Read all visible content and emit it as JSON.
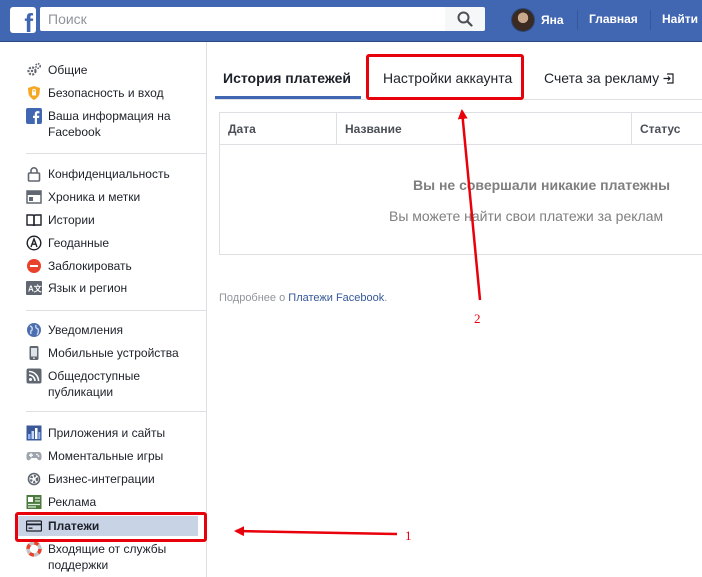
{
  "topbar": {
    "logo": "f",
    "search_placeholder": "Поиск",
    "user_name": "Яна",
    "home_label": "Главная",
    "find_friends_label": "Найти"
  },
  "sidebar": {
    "groups": [
      [
        {
          "icon": "gear-icon",
          "label": "Общие"
        },
        {
          "icon": "shield-icon",
          "label": "Безопасность и вход"
        },
        {
          "icon": "facebook-icon",
          "label": "Ваша информация на Facebook"
        }
      ],
      [
        {
          "icon": "lock-icon",
          "label": "Конфиденциальность"
        },
        {
          "icon": "timeline-icon",
          "label": "Хроника и метки"
        },
        {
          "icon": "book-icon",
          "label": "Истории"
        },
        {
          "icon": "location-icon",
          "label": "Геоданные"
        },
        {
          "icon": "block-icon",
          "label": "Заблокировать"
        },
        {
          "icon": "language-icon",
          "label": "Язык и регион"
        }
      ],
      [
        {
          "icon": "globe-icon",
          "label": "Уведомления"
        },
        {
          "icon": "mobile-icon",
          "label": "Мобильные устройства"
        },
        {
          "icon": "rss-icon",
          "label": "Общедоступные публикации"
        }
      ],
      [
        {
          "icon": "apps-icon",
          "label": "Приложения и сайты"
        },
        {
          "icon": "gamepad-icon",
          "label": "Моментальные игры"
        },
        {
          "icon": "business-icon",
          "label": "Бизнес-интеграции"
        },
        {
          "icon": "ads-icon",
          "label": "Реклама"
        },
        {
          "icon": "card-icon",
          "label": "Платежи"
        },
        {
          "icon": "lifebuoy-icon",
          "label": "Входящие от службы поддержки"
        }
      ]
    ]
  },
  "tabs": [
    {
      "label": "История платежей"
    },
    {
      "label": "Настройки аккаунта"
    },
    {
      "label": "Счета за рекламу"
    }
  ],
  "table": {
    "columns": [
      "Дата",
      "Название",
      "Статус"
    ],
    "empty_title": "Вы не совершали никакие платежны",
    "empty_subtitle": "Вы можете найти свои платежи за реклам"
  },
  "footnote": {
    "prefix": "Подробнее о ",
    "link": "Платежи Facebook",
    "suffix": "."
  },
  "annotations": {
    "label_1": "1",
    "label_2": "2"
  },
  "colors": {
    "brand": "#4267b2",
    "annotation": "#e8000b",
    "active_item_bg": "#c9d3e6"
  }
}
